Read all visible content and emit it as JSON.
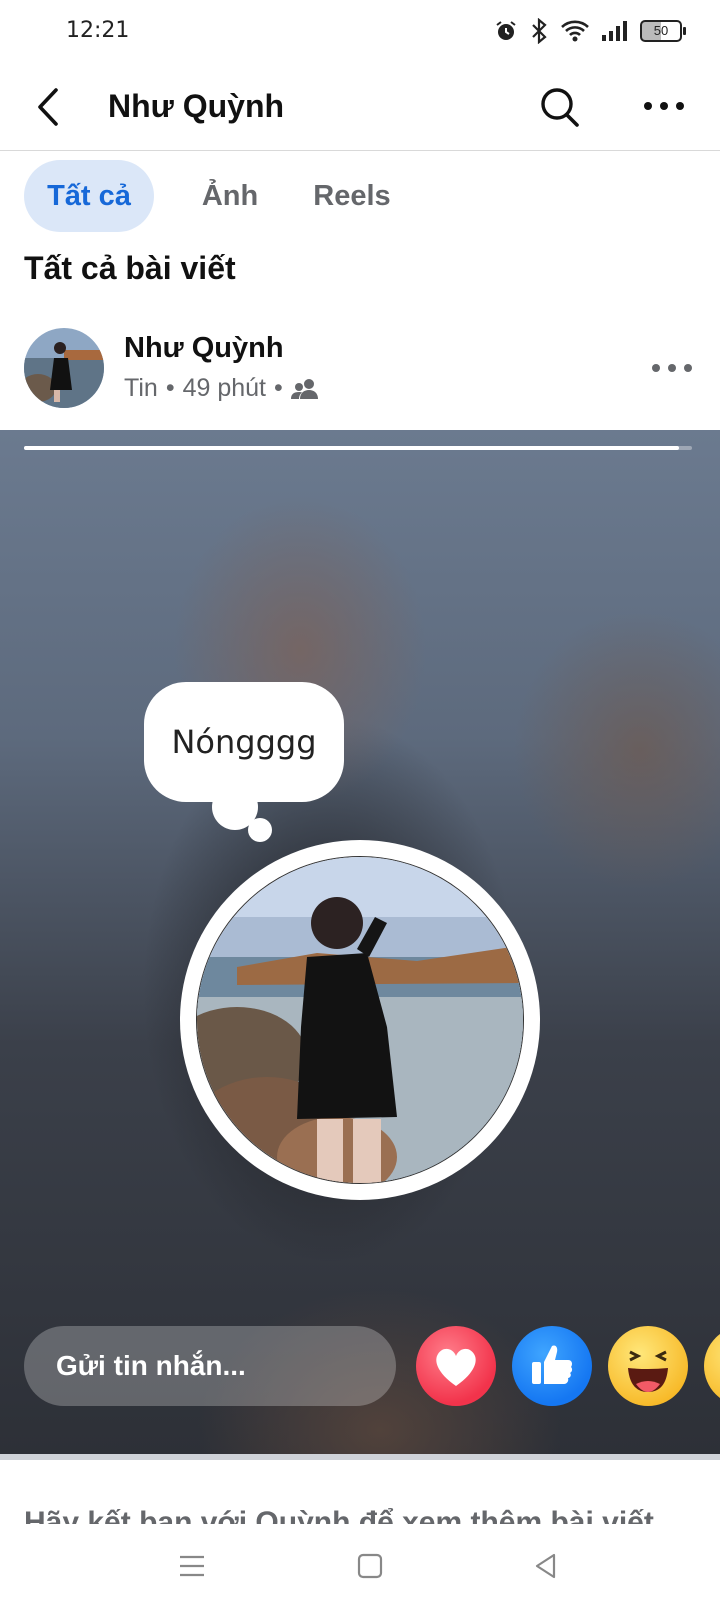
{
  "status_bar": {
    "time": "12:21",
    "battery": "50"
  },
  "header": {
    "title": "Như Quỳnh"
  },
  "tabs": [
    {
      "label": "Tất cả",
      "active": true
    },
    {
      "label": "Ảnh"
    },
    {
      "label": "Reels"
    }
  ],
  "section_title": "Tất cả bài viết",
  "post": {
    "author": "Như Quỳnh",
    "type": "Tin",
    "time": "49 phút",
    "separator": "•",
    "audience_icon": "friends-icon"
  },
  "story": {
    "progress": 0.98,
    "thought_bubble": "Nóngggg",
    "reply_placeholder": "Gửi tin nhắn...",
    "reactions": [
      "heart-icon",
      "like-icon",
      "haha-icon",
      "wow-icon"
    ]
  },
  "footer_text": "Hãy kết bạn với Quỳnh để xem thêm bài viết",
  "colors": {
    "accent": "#1668d8",
    "tab_active_bg": "#dbe7f8",
    "love": "#f2334b",
    "like": "#1577f2",
    "haha": "#f7b928"
  }
}
